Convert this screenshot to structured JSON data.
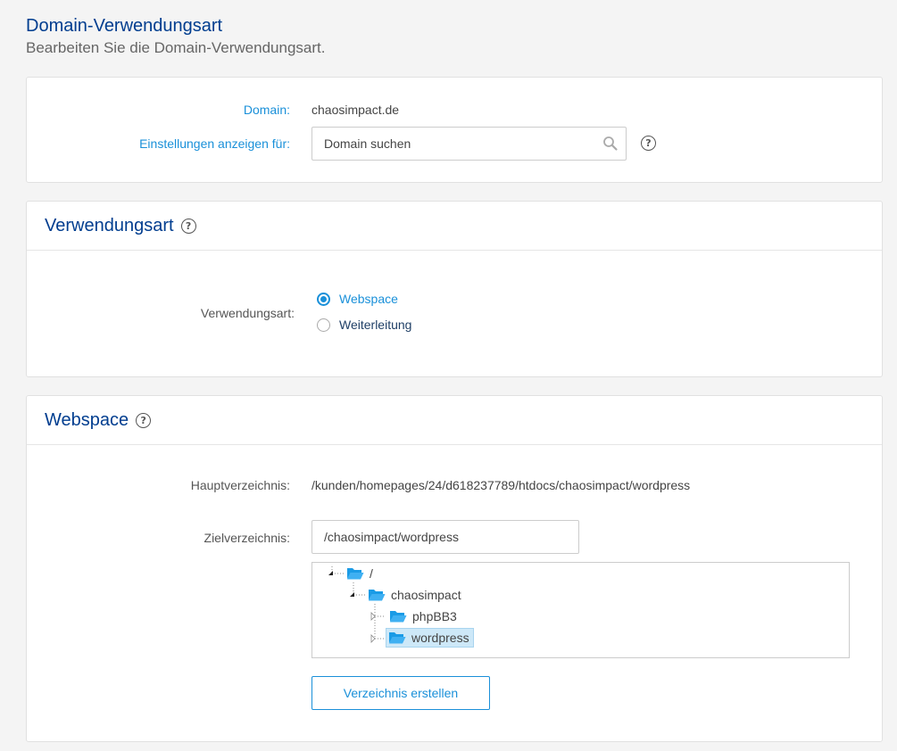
{
  "header": {
    "title": "Domain-Verwendungsart",
    "subtitle": "Bearbeiten Sie die Domain-Verwendungsart."
  },
  "domain_card": {
    "domain_label": "Domain:",
    "domain_value": "chaosimpact.de",
    "settings_label": "Einstellungen anzeigen für:",
    "search_placeholder": "Domain suchen",
    "search_icon": "search-icon",
    "help_icon": "help-icon"
  },
  "usage_card": {
    "title": "Verwendungsart",
    "field_label": "Verwendungsart:",
    "options": [
      {
        "label": "Webspace",
        "checked": true
      },
      {
        "label": "Weiterleitung",
        "checked": false
      }
    ]
  },
  "webspace_card": {
    "title": "Webspace",
    "main_dir_label": "Hauptverzeichnis:",
    "main_dir_value": "/kunden/homepages/24/d618237789/htdocs/chaosimpact/wordpress",
    "target_dir_label": "Zielverzeichnis:",
    "target_dir_value": "/chaosimpact/wordpress",
    "tree": [
      {
        "label": "/",
        "level": 0
      },
      {
        "label": "chaosimpact",
        "level": 1
      },
      {
        "label": "phpBB3",
        "level": 2
      },
      {
        "label": "wordpress",
        "level": 2,
        "selected": true
      }
    ],
    "create_button": "Verzeichnis erstellen"
  },
  "colors": {
    "accent": "#1a90d9",
    "title": "#003d8f",
    "folder": "#1a9be6",
    "selected_bg": "#cde8f8"
  }
}
